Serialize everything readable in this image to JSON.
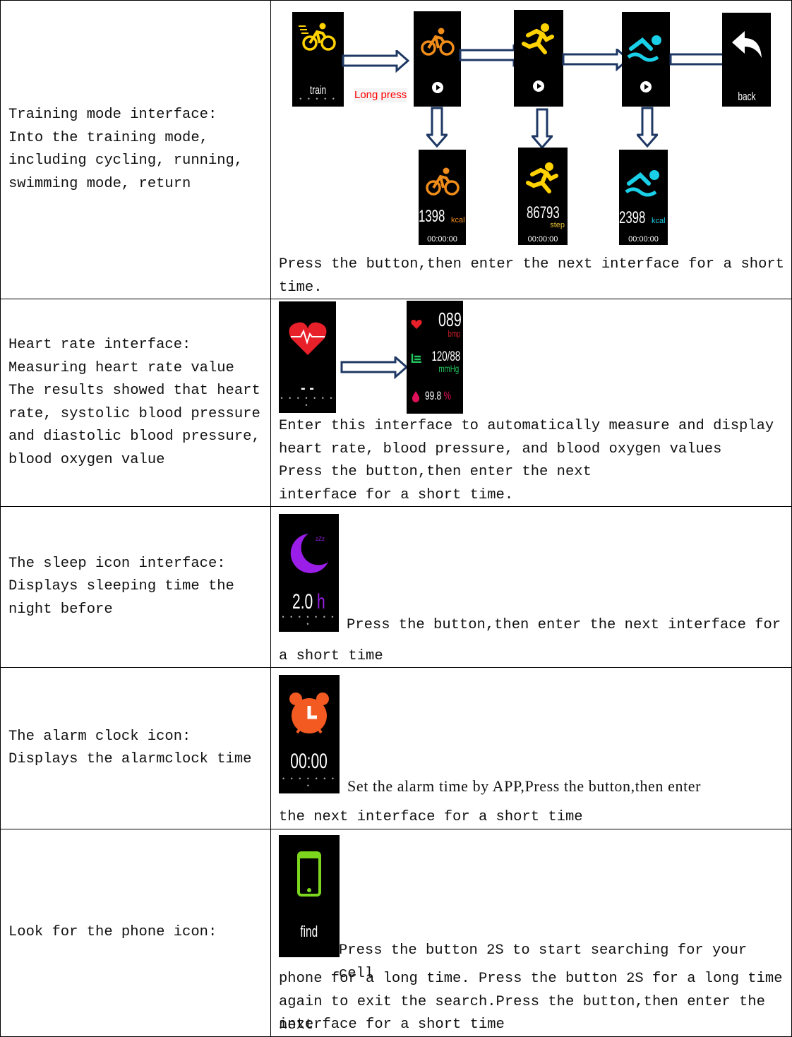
{
  "rows": [
    {
      "left": [
        "Training mode interface:",
        "Into the training mode,",
        "including cycling, running,",
        "swimming mode, return"
      ],
      "right": "Press the button,then enter the next interface for a short time.",
      "screens": {
        "train": "train",
        "long_press": "Long press",
        "back": "back",
        "cycle_value": "1398",
        "cycle_unit": "kcal",
        "run_value": "86793",
        "run_unit": "step",
        "swim_value": "2398",
        "swim_unit": "kcal",
        "timer": "00:00:00"
      }
    },
    {
      "left": [
        "Heart rate interface:",
        "Measuring heart rate value",
        "The results showed that heart",
        "rate, systolic blood pressure",
        "and diastolic blood pressure,",
        "blood oxygen value"
      ],
      "right": [
        "Enter this interface to automatically measure and display",
        "heart rate, blood pressure, and blood oxygen values",
        "Press the button,then enter the next",
        "interface for a short time."
      ],
      "screens": {
        "dash": "- -",
        "hr": "089",
        "hr_unit": "bmp",
        "bp": "120/88",
        "bp_unit": "mmHg",
        "spo2": "99.8",
        "spo2_unit": "%"
      }
    },
    {
      "left": [
        "The sleep icon interface:",
        "Displays sleeping time the",
        "night before"
      ],
      "right": [
        "Press the button,then enter the next interface for",
        "a short time"
      ],
      "screens": {
        "sleep_value": "2.0",
        "sleep_unit": "h",
        "zzz": "zZz"
      }
    },
    {
      "left": [
        "The alarm clock icon:",
        "Displays the alarmclock time"
      ],
      "right": [
        "Set the alarm time by APP,Press the button,then enter",
        "the next interface for a short time"
      ],
      "screens": {
        "alarm": "00:00"
      }
    },
    {
      "left": [
        "Look for the phone icon:"
      ],
      "right": [
        "Press the button 2S to start searching for your cell",
        "phone for a long time. Press the button 2S for a long time",
        "again to exit the search.Press the button,then enter the next",
        "interface for a short time"
      ],
      "screens": {
        "find": "find"
      }
    }
  ],
  "colors": {
    "arrow": "#1f3864",
    "cycle": "#f08c1a",
    "run": "#ffd200",
    "swim": "#1ad0e8",
    "heart": "#e8202a",
    "bp": "#22c55e",
    "sleep": "#9b1ee8",
    "alarm": "#f25a22",
    "phone": "#7cd61e",
    "long_press": "#ff0000"
  }
}
